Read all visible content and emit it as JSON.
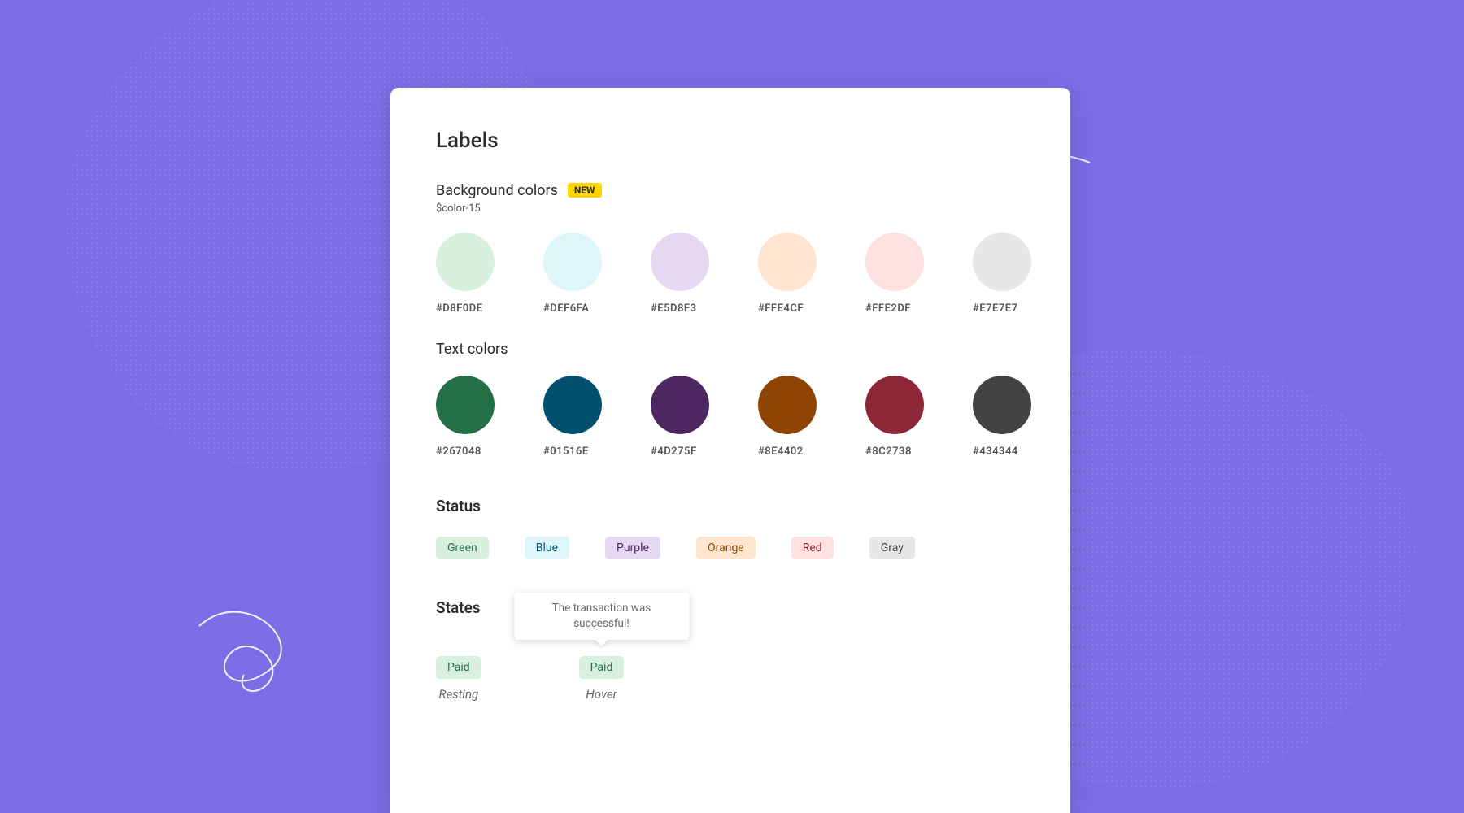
{
  "title": "Labels",
  "bg_section": {
    "title": "Background colors",
    "badge": "NEW",
    "token": "$color-15"
  },
  "bg_swatches": [
    {
      "hex": "#D8F0DE"
    },
    {
      "hex": "#DEF6FA"
    },
    {
      "hex": "#E5D8F3"
    },
    {
      "hex": "#FFE4CF"
    },
    {
      "hex": "#FFE2DF"
    },
    {
      "hex": "#E7E7E7"
    }
  ],
  "text_section": {
    "title": "Text colors"
  },
  "text_swatches": [
    {
      "hex": "#267048"
    },
    {
      "hex": "#01516E"
    },
    {
      "hex": "#4D275F"
    },
    {
      "hex": "#8E4402"
    },
    {
      "hex": "#8C2738"
    },
    {
      "hex": "#434344"
    }
  ],
  "status": {
    "title": "Status",
    "chips": [
      {
        "label": "Green",
        "bg": "#D8F0DE",
        "fg": "#267048"
      },
      {
        "label": "Blue",
        "bg": "#DEF6FA",
        "fg": "#01516E"
      },
      {
        "label": "Purple",
        "bg": "#E5D8F3",
        "fg": "#4D275F"
      },
      {
        "label": "Orange",
        "bg": "#FFE4CF",
        "fg": "#8E4402"
      },
      {
        "label": "Red",
        "bg": "#FFE2DF",
        "fg": "#8C2738"
      },
      {
        "label": "Gray",
        "bg": "#E7E7E7",
        "fg": "#434344"
      }
    ]
  },
  "states": {
    "title": "States",
    "resting": {
      "chip": "Paid",
      "label": "Resting"
    },
    "hover": {
      "chip": "Paid",
      "label": "Hover",
      "tooltip": "The transaction was successful!"
    }
  }
}
